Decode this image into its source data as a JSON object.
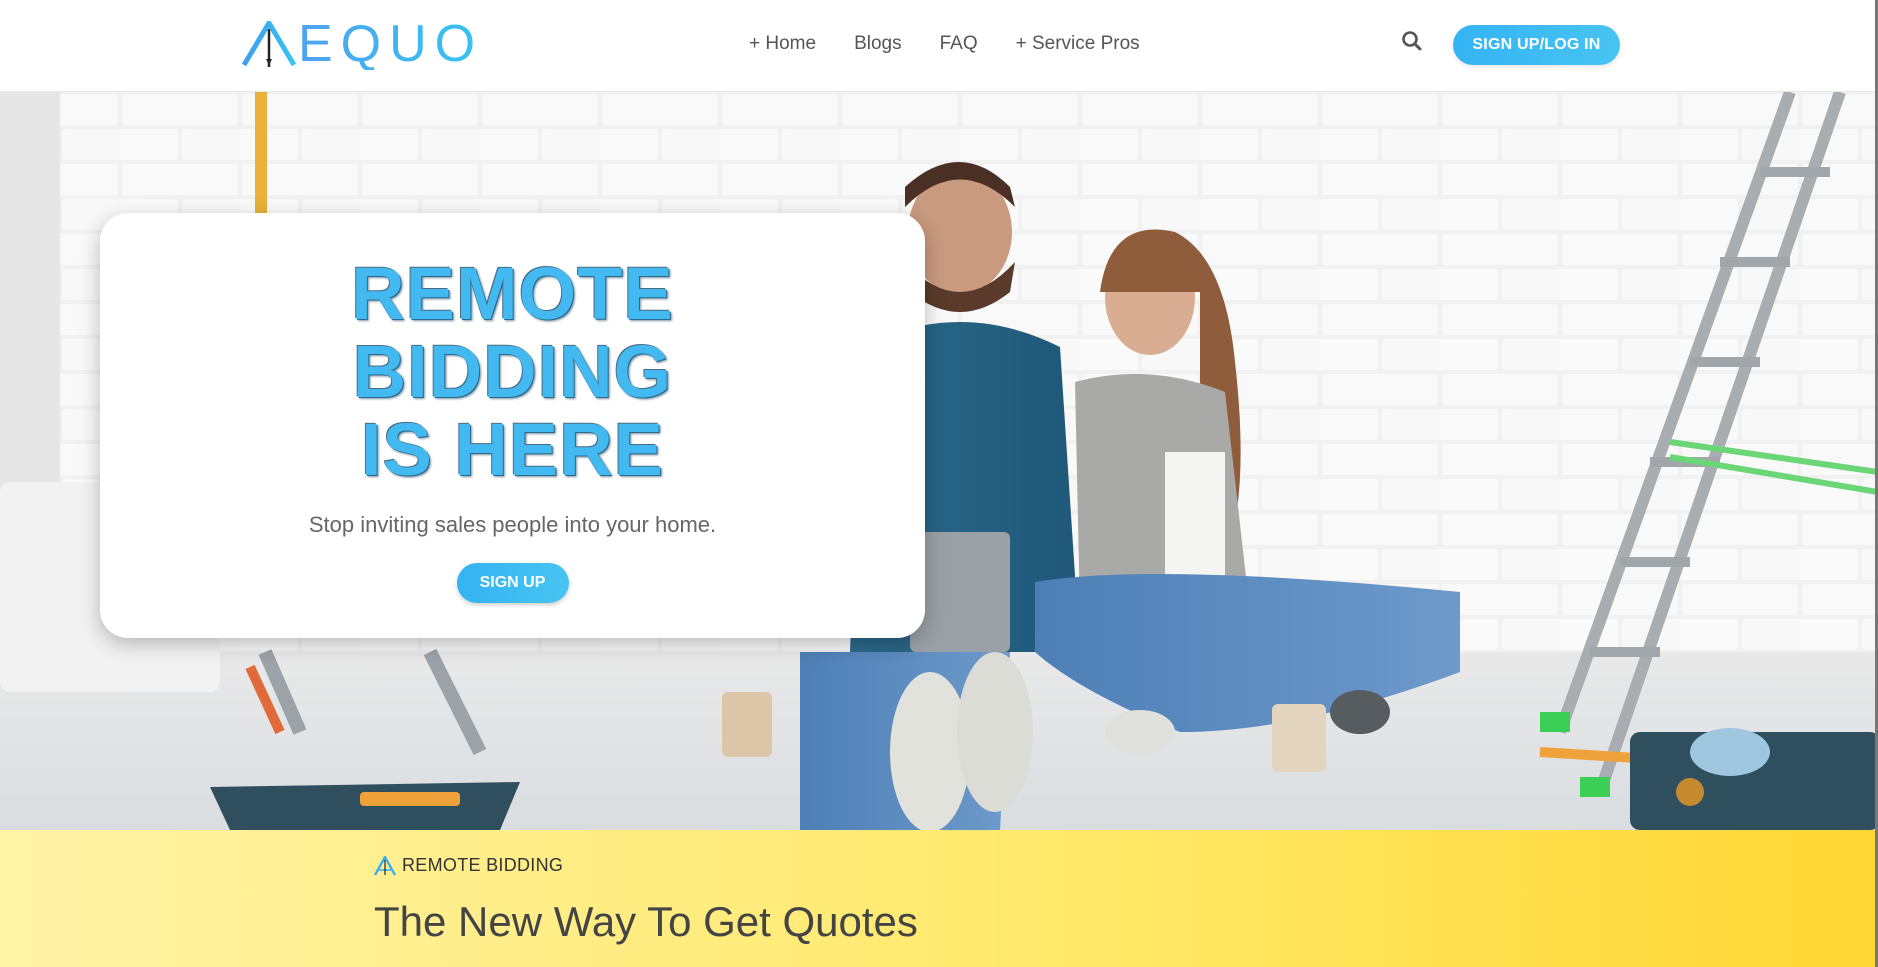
{
  "header": {
    "logo_text": "EQUO",
    "nav": [
      "+ Home",
      "Blogs",
      "FAQ",
      "+ Service Pros"
    ],
    "search_icon": "search-icon",
    "cta_label": "SIGN UP/LOG IN"
  },
  "hero": {
    "title_lines": [
      "REMOTE",
      "BIDDING",
      "IS HERE"
    ],
    "subtitle": "Stop inviting sales people into your home.",
    "button_label": "SIGN UP"
  },
  "section": {
    "eyebrow": "REMOTE BIDDING",
    "title": "The New Way To Get Quotes"
  },
  "colors": {
    "accent": "#42b9f1",
    "band_start": "#fff3a6",
    "band_end": "#ffd633"
  }
}
